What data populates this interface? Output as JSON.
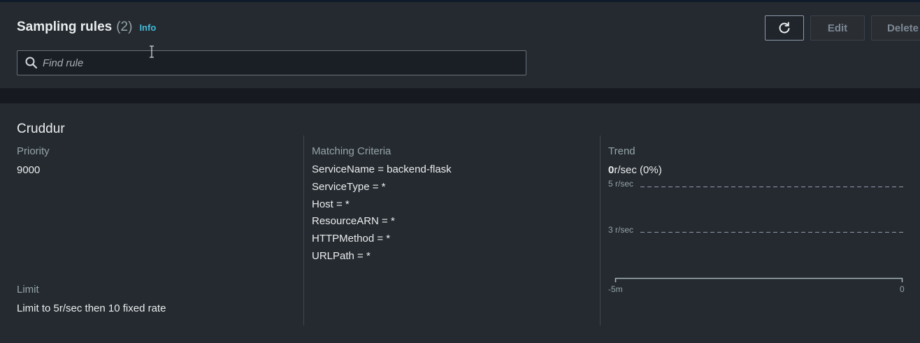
{
  "header": {
    "title": "Sampling rules",
    "count": "(2)",
    "info_link": "Info",
    "search": {
      "placeholder": "Find rule",
      "value": ""
    },
    "buttons": {
      "refresh_icon": "refresh-icon",
      "edit_label": "Edit",
      "delete_label": "Delete"
    }
  },
  "rule": {
    "name": "Cruddur",
    "priority": {
      "label": "Priority",
      "value": "9000"
    },
    "limit": {
      "label": "Limit",
      "value": "Limit to 5r/sec then 10 fixed rate"
    },
    "matching_criteria": {
      "label": "Matching Criteria",
      "items": [
        "ServiceName = backend-flask",
        "ServiceType = *",
        "Host = *",
        "ResourceARN = *",
        "HTTPMethod = *",
        "URLPath = *"
      ]
    },
    "trend": {
      "label": "Trend",
      "rate": "0",
      "rate_suffix": "r/sec (0%)"
    }
  },
  "chart_data": {
    "type": "line",
    "title": "",
    "ylabel": "",
    "xlabel": "",
    "y_ticks": [
      "5 r/sec",
      "3 r/sec"
    ],
    "x_ticks": [
      "-5m",
      "0"
    ],
    "series": []
  },
  "colors": {
    "background": "#16191f",
    "panel": "#252a31",
    "accent_link": "#44b9d6",
    "text_primary": "#eaeded",
    "text_secondary": "#95a5a6"
  }
}
